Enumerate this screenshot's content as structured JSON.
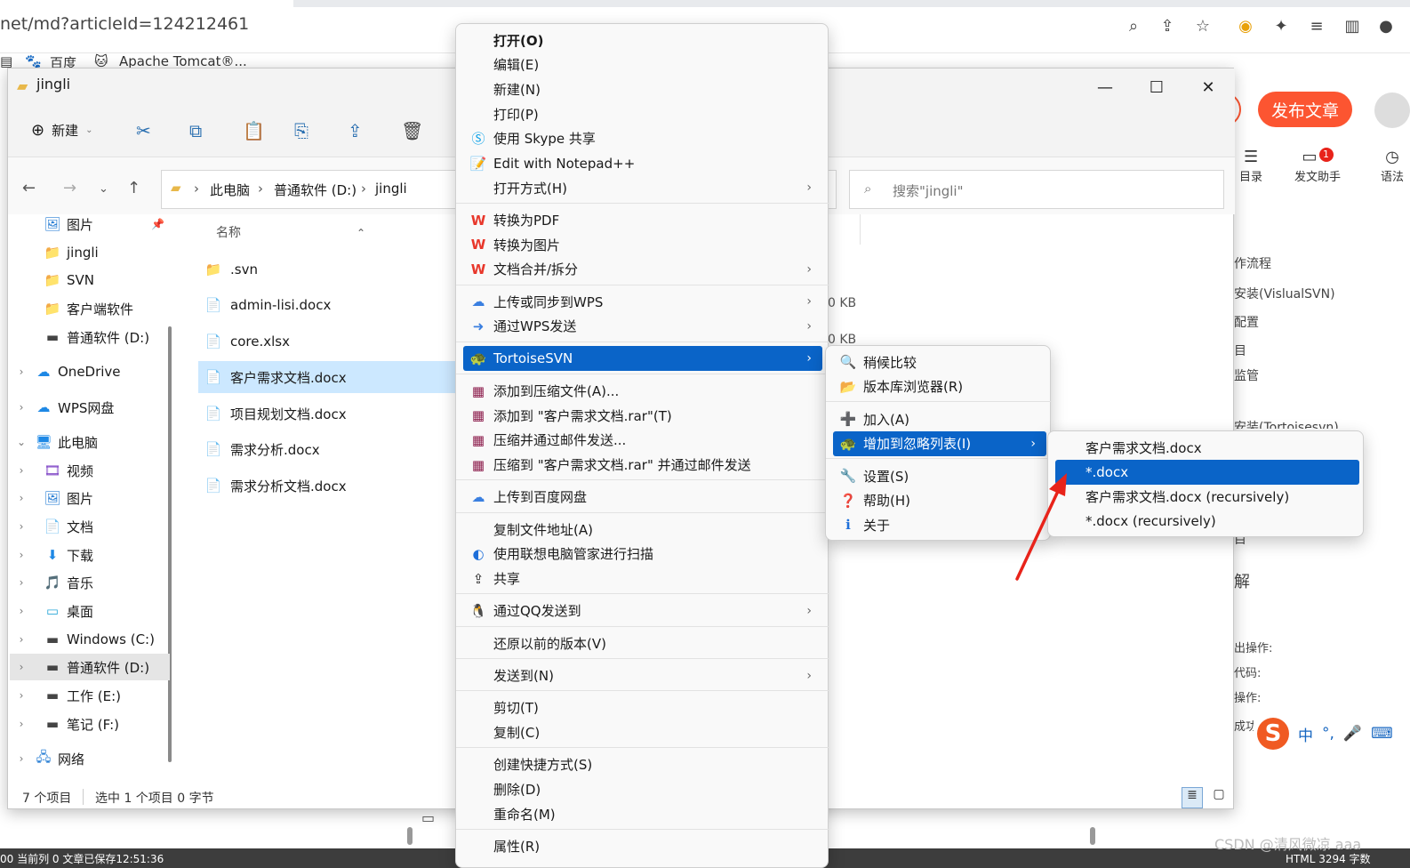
{
  "browser": {
    "url": "net/md?articleId=124212461",
    "icons": [
      "zoom-icon",
      "share-icon",
      "star-icon",
      "chrome-icon",
      "extension-icon",
      "reading-list-icon",
      "sidebar-icon",
      "profile-icon"
    ],
    "bookmarks": [
      {
        "label": "百度"
      },
      {
        "label": "Apache Tomcat®..."
      }
    ]
  },
  "csdn": {
    "publish_label": "发布文章",
    "tools": [
      {
        "label": "目录",
        "icon": "☰"
      },
      {
        "label": "发文助手",
        "icon": "▭",
        "badge": "1"
      },
      {
        "label": "语法",
        "icon": "◷"
      }
    ],
    "texts": [
      "作流程",
      "安装(VislualSVN)",
      "配置",
      "目",
      "监管",
      "安装(Tortoisesvn)",
      "目",
      "解",
      "出操作:",
      "代码:",
      "操作:",
      "成功"
    ],
    "ime": [
      "中",
      "°,",
      "🎤",
      "⌨"
    ],
    "status_left": "00  当前列 0  文章已保存12:51:36",
    "status_right": "HTML  3294 字数",
    "watermark": "CSDN @清风微凉 aaa"
  },
  "explorer": {
    "title": "jingli",
    "toolbar": {
      "new_label": "新建"
    },
    "address": [
      "此电脑",
      "普通软件 (D:)",
      "jingli"
    ],
    "search_placeholder": "搜索\"jingli\"",
    "column_name": "名称",
    "sidebar": [
      {
        "label": "图片",
        "icon": "🖼",
        "indent": 1,
        "chev": "",
        "pin": true
      },
      {
        "label": "jingli",
        "icon": "📁",
        "indent": 1,
        "chev": ""
      },
      {
        "label": "SVN",
        "icon": "📁",
        "indent": 1,
        "chev": ""
      },
      {
        "label": "客户端软件",
        "icon": "📁",
        "indent": 1,
        "chev": ""
      },
      {
        "label": "普通软件 (D:)",
        "icon": "▬",
        "indent": 1,
        "chev": ""
      },
      {
        "label": "OneDrive",
        "icon": "☁",
        "indent": 0,
        "chev": "›"
      },
      {
        "label": "WPS网盘",
        "icon": "☁",
        "indent": 0,
        "chev": "›"
      },
      {
        "label": "此电脑",
        "icon": "🖥",
        "indent": 0,
        "chev": "⌄"
      },
      {
        "label": "视频",
        "icon": "🎞",
        "indent": 1,
        "chev": "›"
      },
      {
        "label": "图片",
        "icon": "🖼",
        "indent": 1,
        "chev": "›"
      },
      {
        "label": "文档",
        "icon": "📄",
        "indent": 1,
        "chev": "›"
      },
      {
        "label": "下载",
        "icon": "⬇",
        "indent": 1,
        "chev": "›"
      },
      {
        "label": "音乐",
        "icon": "🎵",
        "indent": 1,
        "chev": "›"
      },
      {
        "label": "桌面",
        "icon": "▭",
        "indent": 1,
        "chev": "›"
      },
      {
        "label": "Windows (C:)",
        "icon": "▬",
        "indent": 1,
        "chev": "›"
      },
      {
        "label": "普通软件 (D:)",
        "icon": "▬",
        "indent": 1,
        "chev": "›",
        "selected": true
      },
      {
        "label": "工作 (E:)",
        "icon": "▬",
        "indent": 1,
        "chev": "›"
      },
      {
        "label": "笔记 (F:)",
        "icon": "▬",
        "indent": 1,
        "chev": "›"
      },
      {
        "label": "网络",
        "icon": "🖧",
        "indent": 0,
        "chev": "›"
      }
    ],
    "files": [
      {
        "name": ".svn",
        "icon": "📁"
      },
      {
        "name": "admin-lisi.docx",
        "icon": "📄",
        "size": "0 KB"
      },
      {
        "name": "core.xlsx",
        "icon": "📄",
        "size": "0 KB"
      },
      {
        "name": "客户需求文档.docx",
        "icon": "📄",
        "selected": true
      },
      {
        "name": "项目规划文档.docx",
        "icon": "📄"
      },
      {
        "name": "需求分析.docx",
        "icon": "📄"
      },
      {
        "name": "需求分析文档.docx",
        "icon": "📄"
      }
    ],
    "status": {
      "count": "7 个项目",
      "selection": "选中 1 个项目  0 字节"
    }
  },
  "context_menu": {
    "groups": [
      [
        {
          "label": "打开(O)",
          "bold": true
        },
        {
          "label": "编辑(E)"
        },
        {
          "label": "新建(N)"
        },
        {
          "label": "打印(P)"
        },
        {
          "label": "使用 Skype 共享",
          "icon": "Ⓢ",
          "color": "#0aa0e8"
        },
        {
          "label": "Edit with Notepad++",
          "icon": "📝"
        },
        {
          "label": "打开方式(H)",
          "sub": true
        }
      ],
      [
        {
          "label": "转换为PDF",
          "icon": "W",
          "color": "#e8372b"
        },
        {
          "label": "转换为图片",
          "icon": "W",
          "color": "#e8372b"
        },
        {
          "label": "文档合并/拆分",
          "icon": "W",
          "color": "#e8372b",
          "sub": true
        }
      ],
      [
        {
          "label": "上传或同步到WPS",
          "icon": "☁",
          "color": "#3a7fe0",
          "sub": true
        },
        {
          "label": "通过WPS发送",
          "icon": "➜",
          "color": "#3a7fe0",
          "sub": true
        }
      ],
      [
        {
          "label": "TortoiseSVN",
          "icon": "🐢",
          "sub": true,
          "highlight": true
        }
      ],
      [
        {
          "label": "添加到压缩文件(A)...",
          "icon": "▦",
          "color": "#8b1a4a"
        },
        {
          "label": "添加到 \"客户需求文档.rar\"(T)",
          "icon": "▦",
          "color": "#8b1a4a"
        },
        {
          "label": "压缩并通过邮件发送...",
          "icon": "▦",
          "color": "#8b1a4a"
        },
        {
          "label": "压缩到 \"客户需求文档.rar\" 并通过邮件发送",
          "icon": "▦",
          "color": "#8b1a4a"
        }
      ],
      [
        {
          "label": "上传到百度网盘",
          "icon": "☁",
          "color": "#3a7fe0"
        }
      ],
      [
        {
          "label": "复制文件地址(A)"
        },
        {
          "label": "使用联想电脑管家进行扫描",
          "icon": "◐",
          "color": "#1e6fd9"
        },
        {
          "label": "共享",
          "icon": "⇪"
        }
      ],
      [
        {
          "label": "通过QQ发送到",
          "icon": "🐧",
          "sub": true
        }
      ],
      [
        {
          "label": "还原以前的版本(V)"
        }
      ],
      [
        {
          "label": "发送到(N)",
          "sub": true
        }
      ],
      [
        {
          "label": "剪切(T)"
        },
        {
          "label": "复制(C)"
        }
      ],
      [
        {
          "label": "创建快捷方式(S)"
        },
        {
          "label": "删除(D)"
        },
        {
          "label": "重命名(M)"
        }
      ],
      [
        {
          "label": "属性(R)"
        }
      ]
    ]
  },
  "svn_menu": {
    "groups": [
      [
        {
          "label": "稍候比较",
          "icon": "🔍"
        },
        {
          "label": "版本库浏览器(R)",
          "icon": "📂"
        }
      ],
      [
        {
          "label": "加入(A)",
          "icon": "➕",
          "color": "#1e6fd9"
        },
        {
          "label": "增加到忽略列表(I)",
          "icon": "🐢",
          "sub": true,
          "highlight": true
        }
      ],
      [
        {
          "label": "设置(S)",
          "icon": "🔧"
        },
        {
          "label": "帮助(H)",
          "icon": "❓"
        },
        {
          "label": "关于",
          "icon": "ℹ",
          "color": "#1e6fd9"
        }
      ]
    ]
  },
  "ignore_menu": {
    "items": [
      {
        "label": "客户需求文档.docx"
      },
      {
        "label": "*.docx",
        "highlight": true
      },
      {
        "label": "客户需求文档.docx (recursively)"
      },
      {
        "label": "*.docx (recursively)"
      }
    ]
  },
  "colors": {
    "accent": "#0a64c8",
    "annotation": "#e8231a",
    "publish": "#fc5531"
  }
}
